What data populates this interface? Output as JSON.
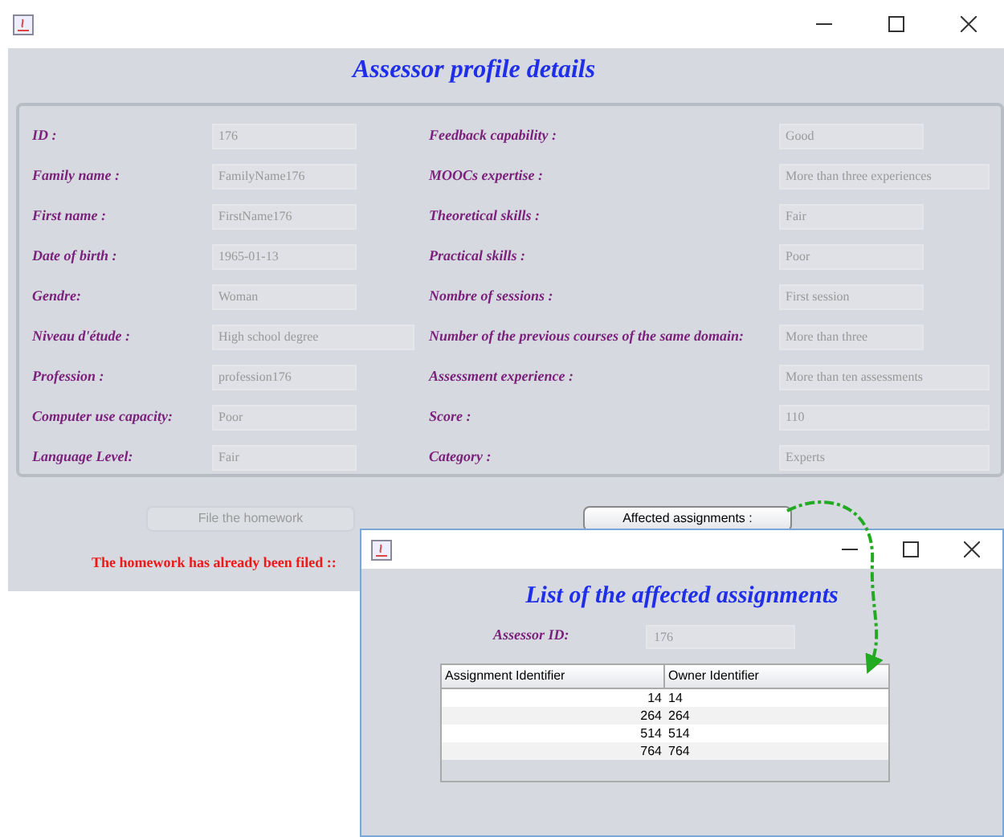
{
  "main_window": {
    "title": "Assessor profile details",
    "left_fields": [
      {
        "label": "ID :",
        "value": "176",
        "wide": false
      },
      {
        "label": "Family name :",
        "value": "FamilyName176",
        "wide": false
      },
      {
        "label": "First name :",
        "value": "FirstName176",
        "wide": false
      },
      {
        "label": "Date of birth :",
        "value": "1965-01-13",
        "wide": false
      },
      {
        "label": "Gendre:",
        "value": "Woman",
        "wide": false
      },
      {
        "label": "Niveau d'étude :",
        "value": "High school degree",
        "wide": true
      },
      {
        "label": "Profession :",
        "value": "profession176",
        "wide": false
      },
      {
        "label": "Computer use capacity:",
        "value": "Poor",
        "wide": false
      },
      {
        "label": "Language Level:",
        "value": "Fair",
        "wide": false
      }
    ],
    "right_fields": [
      {
        "label": "Feedback capability :",
        "value": "Good",
        "wide": false
      },
      {
        "label": "MOOCs expertise  :",
        "value": "More than three experiences",
        "wide": true
      },
      {
        "label": "Theoretical skills :",
        "value": "Fair",
        "wide": false
      },
      {
        "label": "Practical skills :",
        "value": "Poor",
        "wide": false
      },
      {
        "label": "Nombre of sessions :",
        "value": "First session",
        "wide": false
      },
      {
        "label": "Number of the previous courses of the same domain:",
        "value": "More than three",
        "wide": false
      },
      {
        "label": "Assessment experience :",
        "value": "More than ten assessments",
        "wide": true
      },
      {
        "label": "Score :",
        "value": "110",
        "wide": true
      },
      {
        "label": "Category :",
        "value": "Experts",
        "wide": true
      }
    ],
    "buttons": [
      {
        "label": "File the homework",
        "disabled": true
      },
      {
        "label": "Affected assignments :",
        "disabled": false
      }
    ],
    "message": "The homework has already been filed ::"
  },
  "dialog": {
    "title": "List of the affected assignments",
    "id_label": "Assessor ID:",
    "id_value": "176",
    "table": {
      "columns": [
        "Assignment Identifier",
        "Owner Identifier"
      ],
      "rows": [
        [
          "14",
          "14"
        ],
        [
          "264",
          "264"
        ],
        [
          "514",
          "514"
        ],
        [
          "764",
          "764"
        ]
      ]
    }
  }
}
